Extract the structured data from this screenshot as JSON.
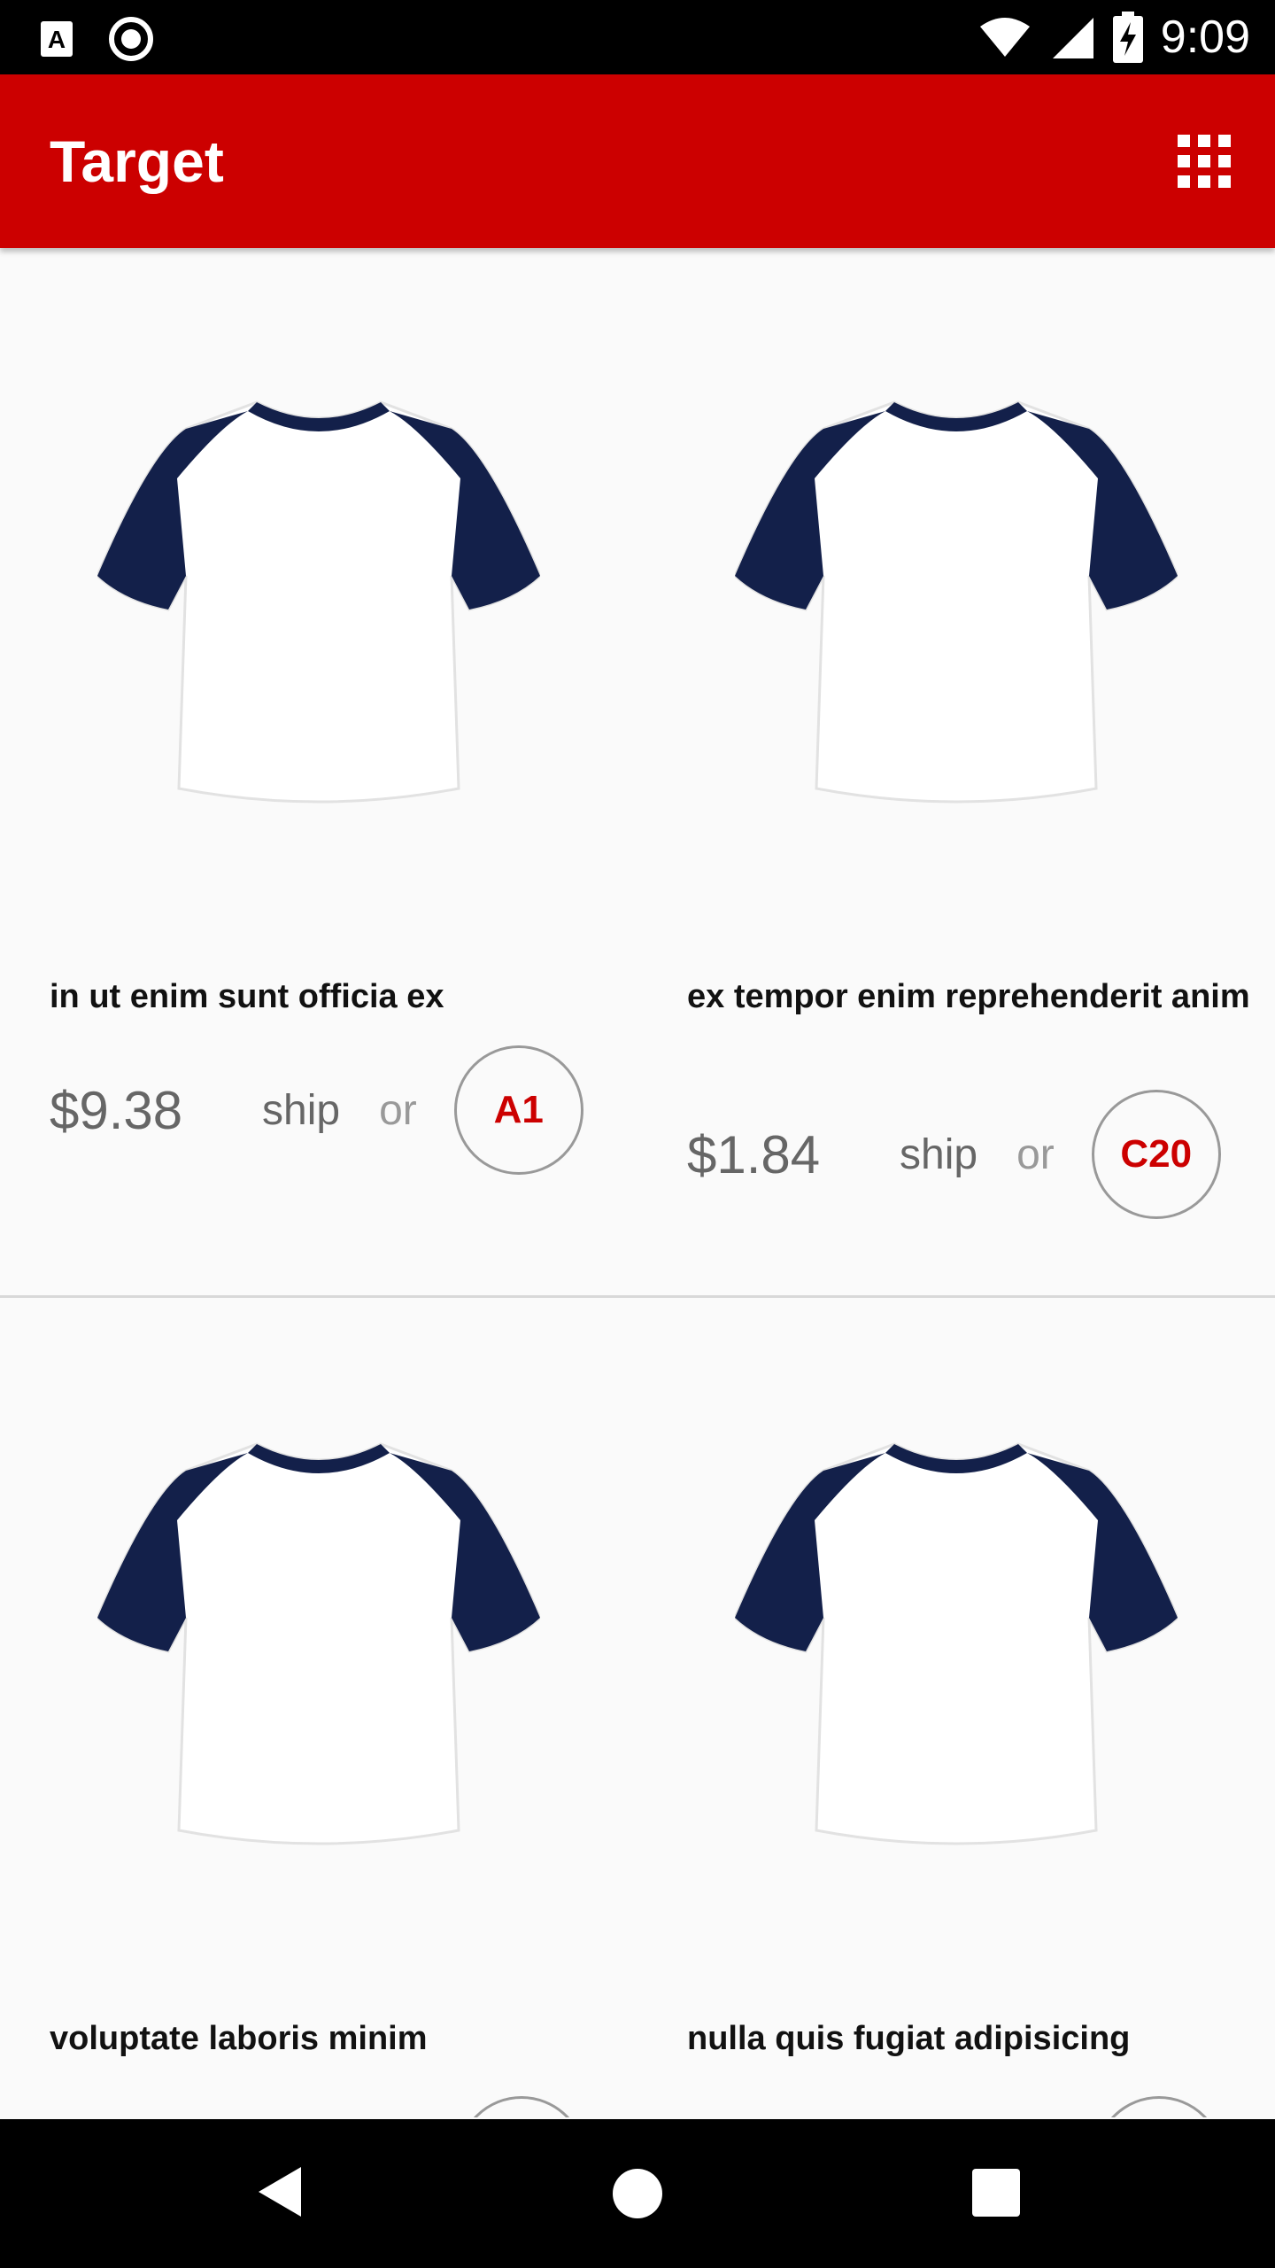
{
  "status_bar": {
    "time": "9:09",
    "left_icons": [
      "a-notification-icon",
      "record-icon"
    ],
    "right_icons": [
      "wifi-icon",
      "signal-icon",
      "battery-charging-icon"
    ]
  },
  "app_bar": {
    "title": "Target",
    "grid_icon": "grid-icon"
  },
  "colors": {
    "brand": "#cc0000",
    "shirt_sleeve": "#13204a"
  },
  "products": [
    {
      "name": "in ut enim sunt officia ex",
      "price": "$9.38",
      "ship_label": "ship",
      "or_label": "or",
      "aisle": "A1",
      "image": "tshirt-image"
    },
    {
      "name": "ex tempor enim reprehenderit anim",
      "price": "$1.84",
      "ship_label": "ship",
      "or_label": "or",
      "aisle": "C20",
      "image": "tshirt-image"
    },
    {
      "name": "voluptate laboris minim",
      "price": "",
      "ship_label": "",
      "or_label": "",
      "aisle": "",
      "image": "tshirt-image"
    },
    {
      "name": "nulla quis fugiat adipisicing",
      "price": "",
      "ship_label": "",
      "or_label": "",
      "aisle": "",
      "image": "tshirt-image"
    }
  ],
  "nav_bar": {
    "back": "back-icon",
    "home": "home-icon",
    "recents": "recents-icon"
  }
}
